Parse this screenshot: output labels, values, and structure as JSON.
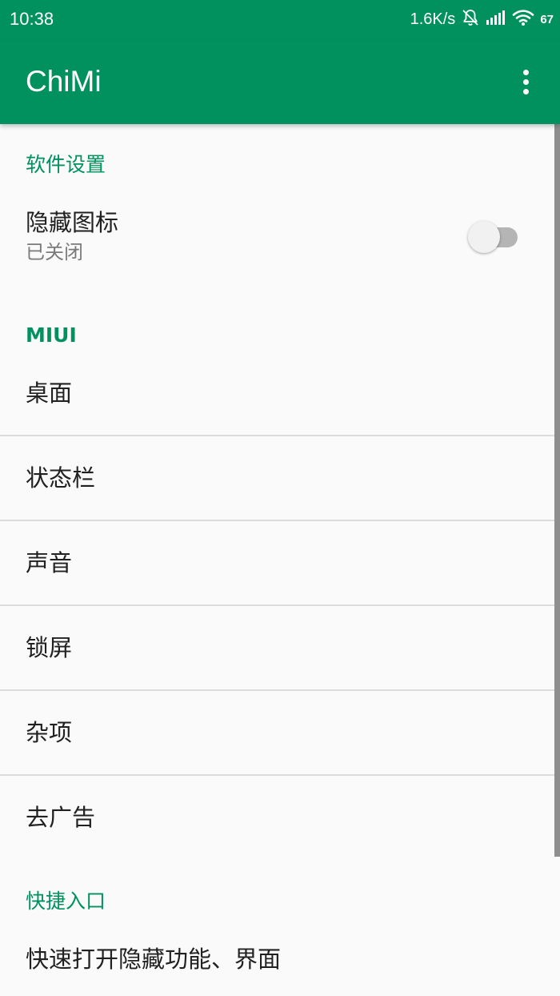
{
  "status_bar": {
    "time": "10:38",
    "net_speed": "1.6K/s",
    "battery": "67",
    "icons": [
      "bell-off-icon",
      "signal-icon",
      "wifi-icon",
      "battery-icon"
    ]
  },
  "app_bar": {
    "title": "ChiMi",
    "menu_icon": "more-vert-icon"
  },
  "sections": {
    "software_settings": {
      "header": "软件设置",
      "hide_icon": {
        "title": "隐藏图标",
        "summary": "已关闭",
        "enabled": false
      }
    },
    "miui": {
      "header": "MIUI",
      "items": [
        "桌面",
        "状态栏",
        "声音",
        "锁屏",
        "杂项",
        "去广告"
      ]
    },
    "shortcuts": {
      "header": "快捷入口",
      "items": [
        "快速打开隐藏功能、界面"
      ]
    }
  },
  "colors": {
    "primary": "#00915f",
    "background": "#fafafa",
    "divider": "#dcdcdc"
  }
}
